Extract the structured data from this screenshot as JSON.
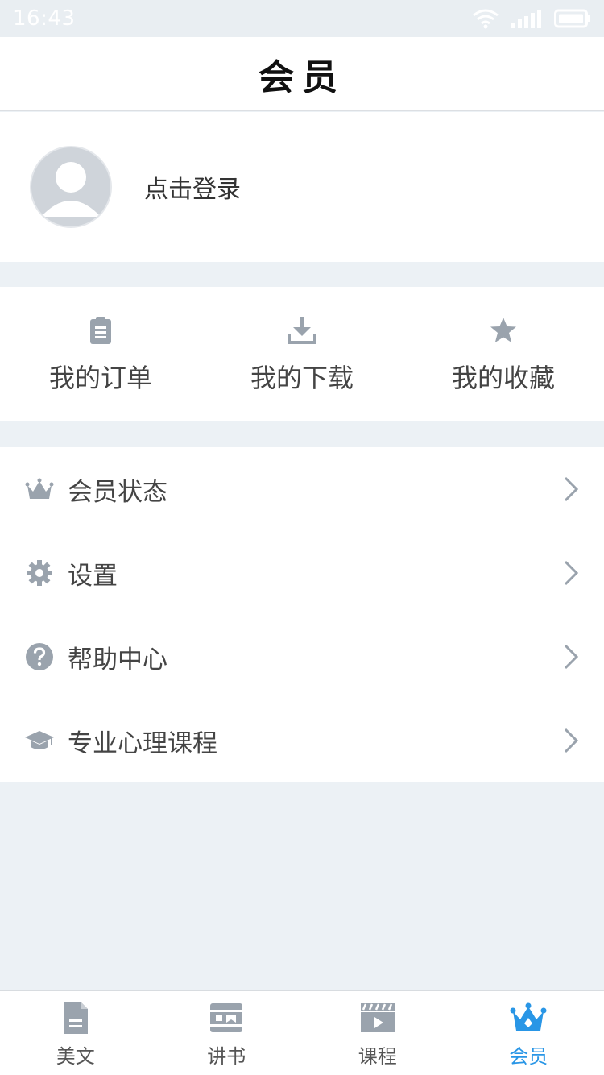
{
  "status_bar": {
    "time": "16:43"
  },
  "header": {
    "title": "会员"
  },
  "profile": {
    "login_text": "点击登录",
    "avatar_icon": "user-avatar-icon"
  },
  "quick_actions": [
    {
      "label": "我的订单",
      "icon": "clipboard-icon"
    },
    {
      "label": "我的下载",
      "icon": "download-icon"
    },
    {
      "label": "我的收藏",
      "icon": "star-icon"
    }
  ],
  "menu": [
    {
      "label": "会员状态",
      "icon": "crown-icon"
    },
    {
      "label": "设置",
      "icon": "gear-icon"
    },
    {
      "label": "帮助中心",
      "icon": "help-circle-icon"
    },
    {
      "label": "专业心理课程",
      "icon": "graduation-cap-icon"
    }
  ],
  "tabs": [
    {
      "label": "美文",
      "icon": "document-icon",
      "active": false
    },
    {
      "label": "讲书",
      "icon": "book-icon",
      "active": false
    },
    {
      "label": "课程",
      "icon": "clapperboard-icon",
      "active": false
    },
    {
      "label": "会员",
      "icon": "crown-icon",
      "active": true
    }
  ],
  "colors": {
    "accent": "#2996e6",
    "icon_gray": "#9aa3ad",
    "background": "#ecf1f5"
  }
}
